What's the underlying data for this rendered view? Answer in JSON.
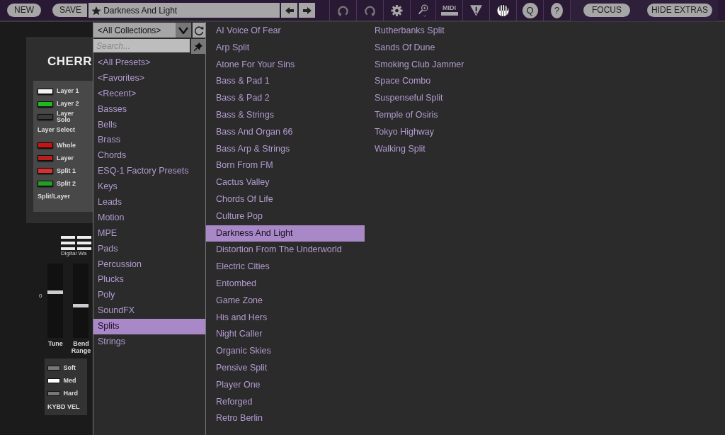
{
  "toolbar": {
    "new_button": "NEW",
    "save_button": "SAVE",
    "preset_name": "Darkness And Light",
    "focus_button": "FOCUS",
    "hide_extras_button": "HIDE EXTRAS",
    "q_button": "Q",
    "help_button": "?",
    "midi_label": "MIDI"
  },
  "synth_panel": {
    "title": "CHERR",
    "brand_caption": "Digital Wa",
    "layer_leds": [
      {
        "label": "Layer 1",
        "color": "#f2f2f2"
      },
      {
        "label": "Layer 2",
        "color": "#1fb81f"
      },
      {
        "label": "Layer Solo",
        "color": "#3a3a3a"
      }
    ],
    "layer_caption": "Layer Select",
    "split_leds": [
      {
        "label": "Whole",
        "color": "#cc1111"
      },
      {
        "label": "Layer",
        "color": "#b82020"
      },
      {
        "label": "Split 1",
        "color": "#d63030"
      },
      {
        "label": "Split 2",
        "color": "#22a022"
      }
    ],
    "split_caption": "Split/Layer",
    "sliders": [
      {
        "label": "Tune",
        "level": 0.62
      },
      {
        "label": "Bend Range",
        "level": 0.43
      }
    ],
    "tune_zero": "0",
    "velocity": [
      {
        "label": "Soft",
        "on": false
      },
      {
        "label": "Med",
        "on": true
      },
      {
        "label": "Hard",
        "on": false
      }
    ],
    "velocity_caption": "KYBD VEL"
  },
  "collections": {
    "value": "<All Collections>",
    "search_placeholder": "Search..."
  },
  "categories": [
    {
      "label": "<All Presets>",
      "selected": false
    },
    {
      "label": "<Favorites>",
      "selected": false
    },
    {
      "label": "<Recent>",
      "selected": false
    },
    {
      "label": "Basses",
      "selected": false
    },
    {
      "label": "Bells",
      "selected": false
    },
    {
      "label": "Brass",
      "selected": false
    },
    {
      "label": "Chords",
      "selected": false
    },
    {
      "label": "ESQ-1 Factory Presets",
      "selected": false
    },
    {
      "label": "Keys",
      "selected": false
    },
    {
      "label": "Leads",
      "selected": false
    },
    {
      "label": "Motion",
      "selected": false
    },
    {
      "label": "MPE",
      "selected": false
    },
    {
      "label": "Pads",
      "selected": false
    },
    {
      "label": "Percussion",
      "selected": false
    },
    {
      "label": "Plucks",
      "selected": false
    },
    {
      "label": "Poly",
      "selected": false
    },
    {
      "label": "SoundFX",
      "selected": false
    },
    {
      "label": "Splits",
      "selected": true
    },
    {
      "label": "Strings",
      "selected": false
    }
  ],
  "presets": [
    {
      "label": "AI Voice Of Fear",
      "selected": false
    },
    {
      "label": "Arp Split",
      "selected": false
    },
    {
      "label": "Atone For Your Sins",
      "selected": false
    },
    {
      "label": "Bass & Pad 1",
      "selected": false
    },
    {
      "label": "Bass & Pad 2",
      "selected": false
    },
    {
      "label": "Bass & Strings",
      "selected": false
    },
    {
      "label": "Bass And Organ 66",
      "selected": false
    },
    {
      "label": "Bass Arp & Strings",
      "selected": false
    },
    {
      "label": "Born From FM",
      "selected": false
    },
    {
      "label": "Cactus Valley",
      "selected": false
    },
    {
      "label": "Chords Of Life",
      "selected": false
    },
    {
      "label": "Culture Pop",
      "selected": false
    },
    {
      "label": "Darkness And Light",
      "selected": true
    },
    {
      "label": "Distortion From The Underworld",
      "selected": false
    },
    {
      "label": "Electric Cities",
      "selected": false
    },
    {
      "label": "Entombed",
      "selected": false
    },
    {
      "label": "Game Zone",
      "selected": false
    },
    {
      "label": "His and Hers",
      "selected": false
    },
    {
      "label": "Night Caller",
      "selected": false
    },
    {
      "label": "Organic Skies",
      "selected": false
    },
    {
      "label": "Pensive Split",
      "selected": false
    },
    {
      "label": "Player One",
      "selected": false
    },
    {
      "label": "Reforged",
      "selected": false
    },
    {
      "label": "Retro Berlin",
      "selected": false
    },
    {
      "label": "Rutherbanks Split",
      "selected": false
    },
    {
      "label": "Sands Of Dune",
      "selected": false
    },
    {
      "label": "Smoking Club Jammer",
      "selected": false
    },
    {
      "label": "Space Combo",
      "selected": false
    },
    {
      "label": "Suspenseful Split",
      "selected": false
    },
    {
      "label": "Temple of Osiris",
      "selected": false
    },
    {
      "label": "Tokyo Highway",
      "selected": false
    },
    {
      "label": "Walking Split",
      "selected": false
    }
  ]
}
